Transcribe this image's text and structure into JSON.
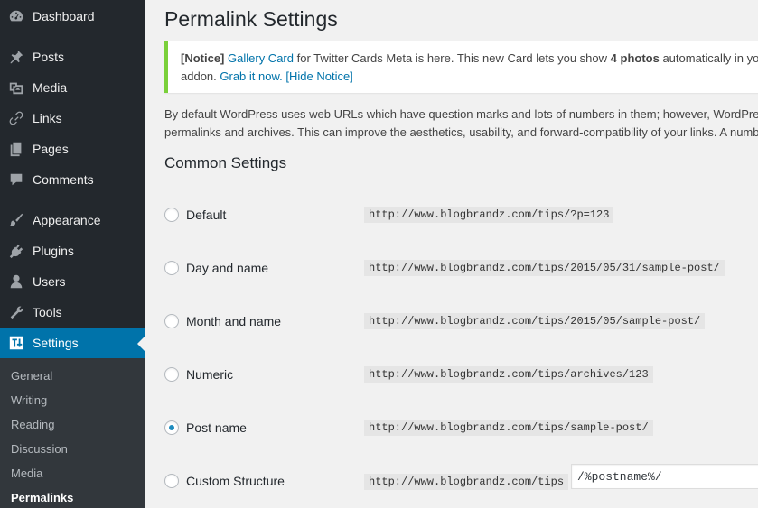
{
  "sidebar": {
    "items": [
      {
        "label": "Dashboard",
        "icon": "dashboard-icon"
      },
      {
        "label": "Posts",
        "icon": "pin-icon"
      },
      {
        "label": "Media",
        "icon": "media-icon"
      },
      {
        "label": "Links",
        "icon": "link-icon"
      },
      {
        "label": "Pages",
        "icon": "pages-icon"
      },
      {
        "label": "Comments",
        "icon": "comment-icon"
      },
      {
        "label": "Appearance",
        "icon": "brush-icon"
      },
      {
        "label": "Plugins",
        "icon": "plugin-icon"
      },
      {
        "label": "Users",
        "icon": "user-icon"
      },
      {
        "label": "Tools",
        "icon": "wrench-icon"
      },
      {
        "label": "Settings",
        "icon": "settings-icon"
      }
    ],
    "submenu": [
      "General",
      "Writing",
      "Reading",
      "Discussion",
      "Media",
      "Permalinks"
    ],
    "colors": {
      "bg": "#23282d",
      "active": "#0073aa",
      "submenu_bg": "#32373c"
    }
  },
  "main": {
    "title": "Permalink Settings",
    "notice": {
      "tag": "[Notice]",
      "link1": "Gallery Card",
      "text1": " for Twitter Cards Meta is here. This new Card lets you show ",
      "bold": "4 photos",
      "text2": " automatically in your Tweets with this",
      "line2_prefix": "addon. ",
      "link2": "Grab it now.",
      "link3": "[Hide Notice]",
      "accent": "#7ad03a"
    },
    "intro_line1": "By default WordPress uses web URLs which have question marks and lots of numbers in them; however, WordPress offers you the ability to create a custom URL structure for your",
    "intro_line2": "permalinks and archives. This can improve the aesthetics, usability, and forward-compatibility of your links. A number of tags are available, and here are some examples to get you started.",
    "section_title": "Common Settings",
    "options": [
      {
        "label": "Default",
        "example": "http://www.blogbrandz.com/tips/?p=123",
        "checked": false
      },
      {
        "label": "Day and name",
        "example": "http://www.blogbrandz.com/tips/2015/05/31/sample-post/",
        "checked": false
      },
      {
        "label": "Month and name",
        "example": "http://www.blogbrandz.com/tips/2015/05/sample-post/",
        "checked": false
      },
      {
        "label": "Numeric",
        "example": "http://www.blogbrandz.com/tips/archives/123",
        "checked": false
      },
      {
        "label": "Post name",
        "example": "http://www.blogbrandz.com/tips/sample-post/",
        "checked": true
      },
      {
        "label": "Custom Structure",
        "example": "http://www.blogbrandz.com/tips",
        "checked": false,
        "input_value": "/%postname%/"
      }
    ]
  }
}
